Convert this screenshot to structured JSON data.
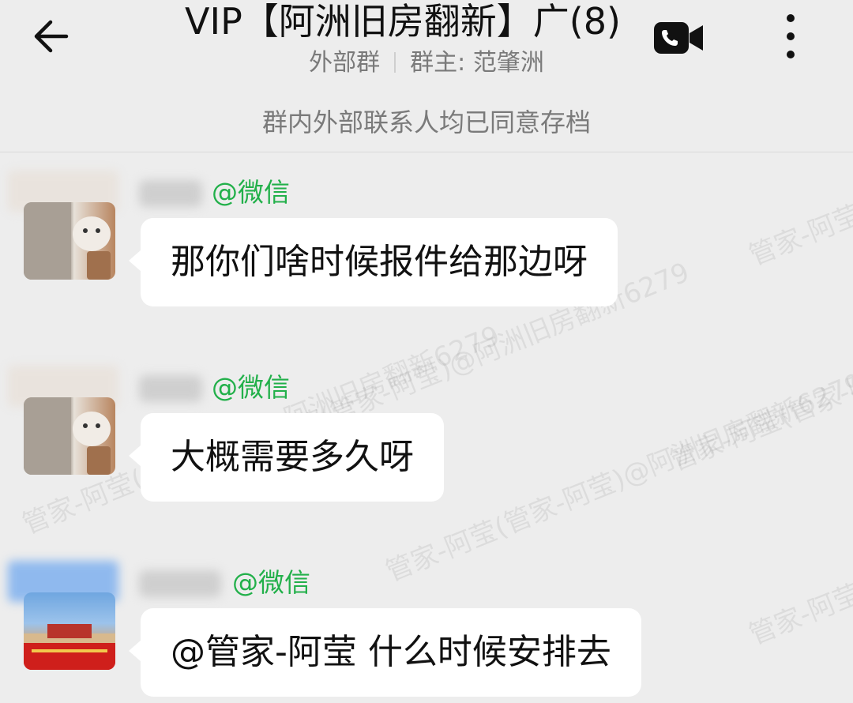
{
  "header": {
    "title": "VIP【阿洲旧房翻新】广(8)",
    "group_type": "外部群",
    "owner": "群主: 范肇洲",
    "notice": "群内外部联系人均已同意存档"
  },
  "icons": {
    "back": "arrow-left-icon",
    "video": "video-call-icon",
    "more": "more-vertical-icon"
  },
  "messages": [
    {
      "source": "@微信",
      "text": "那你们啥时候报件给那边呀"
    },
    {
      "source": "@微信",
      "text": "大概需要多久呀"
    },
    {
      "source": "@微信",
      "text": "@管家-阿莹 什么时候安排去"
    }
  ],
  "watermarks": [
    "管家-阿莹(管家-阿莹)@阿洲旧房翻新6279",
    "管家-阿莹(管家-阿莹)@阿洲旧房翻新6279",
    "管家-阿莹(管家-阿莹)@阿洲旧房翻新6279",
    "管家-阿莹(管家-阿莹)@阿洲旧房翻新6279",
    "管家-阿莹(管家-阿莹)@阿洲旧房翻新6279",
    "管家-阿莹(管家-阿莹)@阿洲旧房翻新6279"
  ],
  "colors": {
    "background": "#ededed",
    "bubble": "#ffffff",
    "source_green": "#22b04a"
  }
}
